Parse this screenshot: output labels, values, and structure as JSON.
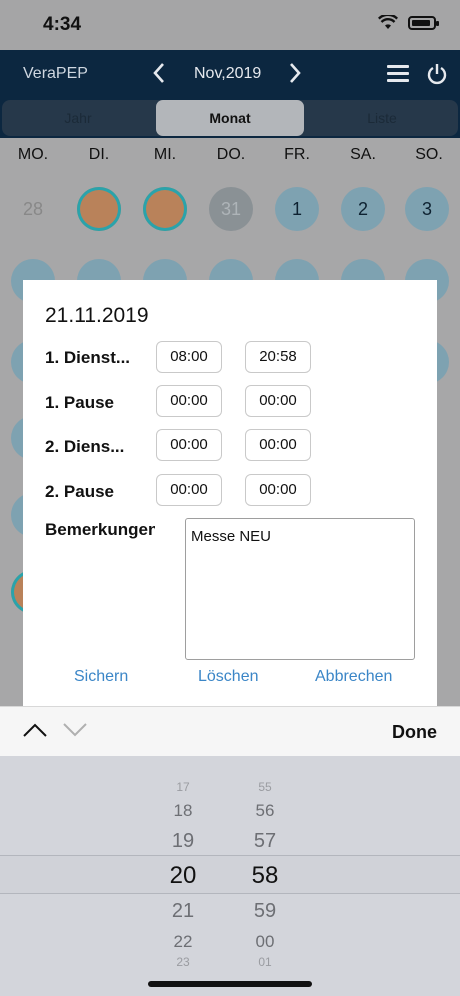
{
  "status": {
    "time": "4:34"
  },
  "nav": {
    "app_title": "VeraPEP",
    "month": "Nov,2019",
    "prev": "‹",
    "next": "›"
  },
  "segments": [
    "Jahr",
    "Monat",
    "Liste"
  ],
  "weekdays": [
    "MO.",
    "DI.",
    "MI.",
    "DO.",
    "FR.",
    "SA.",
    "SO."
  ],
  "calendar": {
    "row1": [
      "28",
      "",
      "",
      "31",
      "1",
      "2",
      "3"
    ]
  },
  "dialog": {
    "date": "21.11.2019",
    "rows": [
      {
        "label": "1. Dienst...",
        "start": "08:00",
        "end": "20:58"
      },
      {
        "label": "1. Pause",
        "start": "00:00",
        "end": "00:00"
      },
      {
        "label": "2. Diens...",
        "start": "00:00",
        "end": "00:00"
      },
      {
        "label": "2. Pause",
        "start": "00:00",
        "end": "00:00"
      }
    ],
    "notes_label": "Bemerkungen",
    "notes_value": "Messe NEU",
    "buttons": {
      "save": "Sichern",
      "delete": "Löschen",
      "cancel": "Abbrechen"
    }
  },
  "toolbar": {
    "done": "Done"
  },
  "picker": {
    "hours": [
      "17",
      "18",
      "19",
      "20",
      "21",
      "22",
      "23"
    ],
    "minutes": [
      "55",
      "56",
      "57",
      "58",
      "59",
      "00",
      "01"
    ],
    "selected_hour": "20",
    "selected_minute": "58"
  },
  "colors": {
    "nav_bg": "#0c2740",
    "accent_blue": "#3b86c7",
    "day_blue": "#7ea2b1",
    "day_orange": "#b9825a"
  }
}
